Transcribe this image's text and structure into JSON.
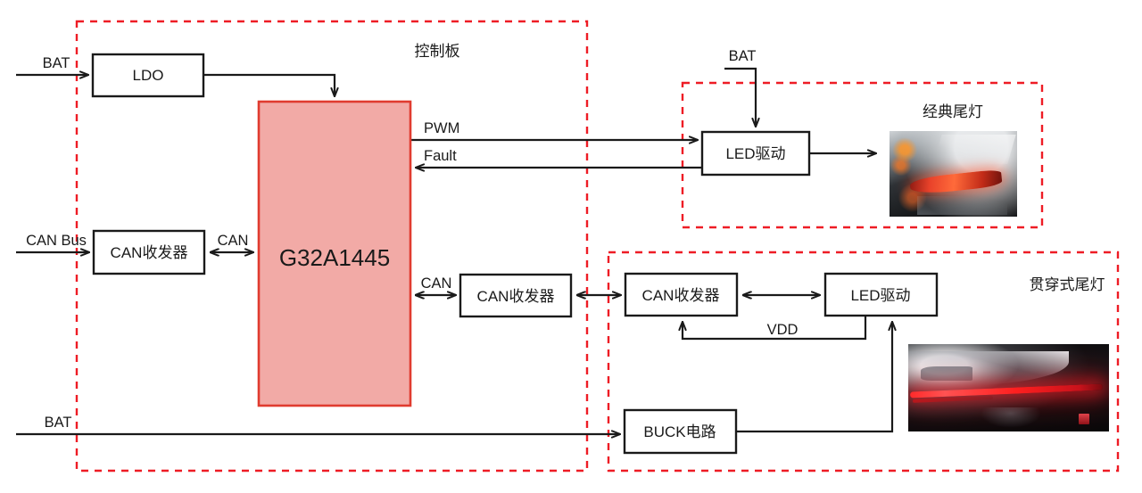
{
  "diagram": {
    "colors": {
      "group_border": "#ee1c25",
      "mcu_fill": "#f2aaa6",
      "mcu_border": "#e03b2f",
      "wire": "#1a1a1a",
      "background": "#ffffff"
    },
    "groups": [
      {
        "id": "control-board",
        "label": "控制板"
      },
      {
        "id": "classic-taillight",
        "label": "经典尾灯"
      },
      {
        "id": "through-taillight",
        "label": "贯穿式尾灯"
      }
    ],
    "blocks": [
      {
        "id": "ldo",
        "label": "LDO"
      },
      {
        "id": "mcu",
        "label": "G32A1445"
      },
      {
        "id": "can-transceiver-left",
        "label": "CAN收发器"
      },
      {
        "id": "can-transceiver-mid",
        "label": "CAN收发器"
      },
      {
        "id": "can-transceiver-right",
        "label": "CAN收发器"
      },
      {
        "id": "led-driver-classic",
        "label": "LED驱动"
      },
      {
        "id": "led-driver-through",
        "label": "LED驱动"
      },
      {
        "id": "buck-circuit",
        "label": "BUCK电路"
      }
    ],
    "signals": [
      {
        "id": "bat-ldo",
        "label": "BAT"
      },
      {
        "id": "bat-led-driver",
        "label": "BAT"
      },
      {
        "id": "bat-buck",
        "label": "BAT"
      },
      {
        "id": "can-bus-in",
        "label": "CAN Bus"
      },
      {
        "id": "can-left",
        "label": "CAN"
      },
      {
        "id": "can-mid",
        "label": "CAN"
      },
      {
        "id": "pwm",
        "label": "PWM"
      },
      {
        "id": "fault",
        "label": "Fault"
      },
      {
        "id": "vdd",
        "label": "VDD"
      }
    ],
    "images": [
      {
        "id": "classic-taillight-photo",
        "alt": "经典尾灯"
      },
      {
        "id": "through-taillight-photo",
        "alt": "贯穿式尾灯"
      }
    ]
  }
}
